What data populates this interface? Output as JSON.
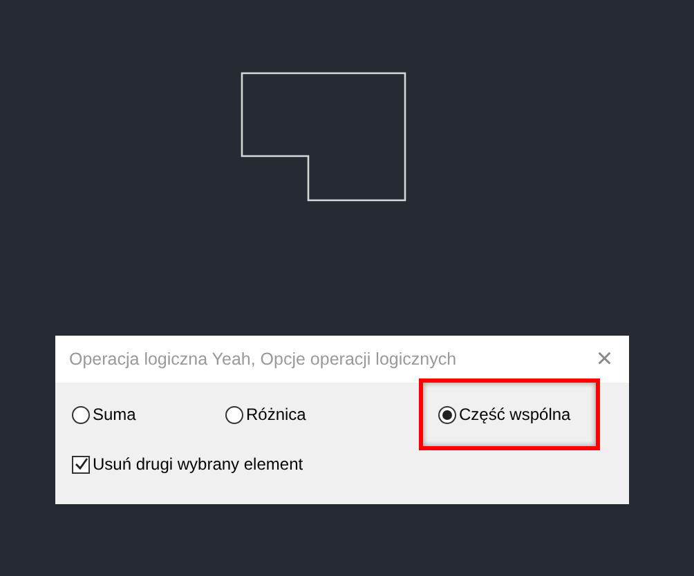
{
  "dialog": {
    "title": "Operacja logiczna Yeah, Opcje operacji logicznych",
    "close": "×",
    "options": [
      {
        "label": "Suma",
        "selected": false,
        "highlighted": false
      },
      {
        "label": "Różnica",
        "selected": false,
        "highlighted": false
      },
      {
        "label": "Część wspólna",
        "selected": true,
        "highlighted": true
      }
    ],
    "checkbox": {
      "label": "Usuń drugi wybrany element",
      "checked": true
    }
  }
}
